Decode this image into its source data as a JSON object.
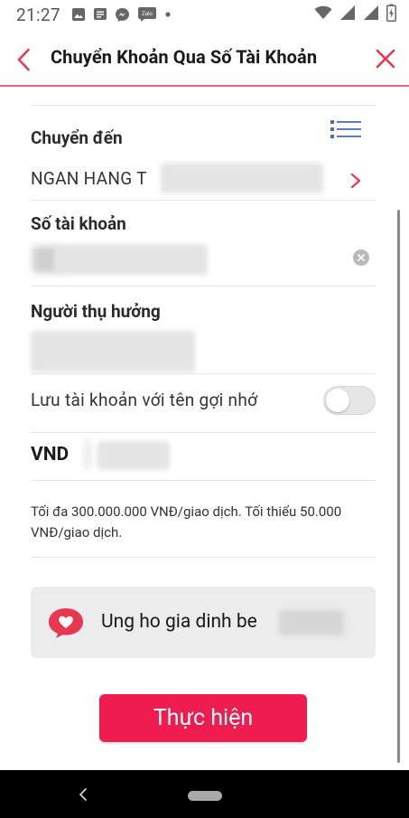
{
  "status_bar": {
    "time": "21:27",
    "notification_icons": [
      "image-icon",
      "message-icon",
      "messenger-icon",
      "zalo-icon",
      "dot-icon"
    ],
    "zalo_label": "Zalo"
  },
  "header": {
    "title": "Chuyển Khoản Qua Số Tài Khoản",
    "accent_color": "#e8384f"
  },
  "form": {
    "transfer_to_label": "Chuyển đến",
    "bank_name": "NGAN HANG T",
    "account_number_label": "Số tài khoản",
    "beneficiary_label": "Người thụ hưởng",
    "save_account_label": "Lưu tài khoản với tên gợi nhớ",
    "save_account_enabled": false,
    "currency": "VND",
    "limit_note": "Tối đa 300.000.000 VNĐ/giao dịch. Tối thiểu 50.000 VNĐ/giao dịch."
  },
  "message": {
    "text": "Ung ho gia dinh be"
  },
  "actions": {
    "submit_label": "Thực hiện",
    "submit_color": "#ef1c50"
  }
}
